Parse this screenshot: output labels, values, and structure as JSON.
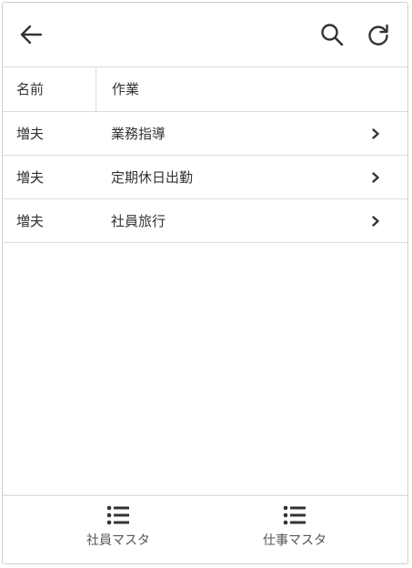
{
  "toolbar": {
    "back_icon": "arrow-left-icon",
    "search_icon": "search-icon",
    "refresh_icon": "refresh-icon"
  },
  "table": {
    "columns": [
      "名前",
      "作業"
    ],
    "rows": [
      {
        "name": "増夫",
        "work": "業務指導"
      },
      {
        "name": "増夫",
        "work": "定期休日出勤"
      },
      {
        "name": "増夫",
        "work": "社員旅行"
      }
    ]
  },
  "bottom_nav": {
    "items": [
      {
        "label": "社員マスタ",
        "icon": "list-icon"
      },
      {
        "label": "仕事マスタ",
        "icon": "list-icon"
      }
    ]
  },
  "colors": {
    "border": "#dcdcdc",
    "text": "#333333",
    "icon": "#333333"
  }
}
